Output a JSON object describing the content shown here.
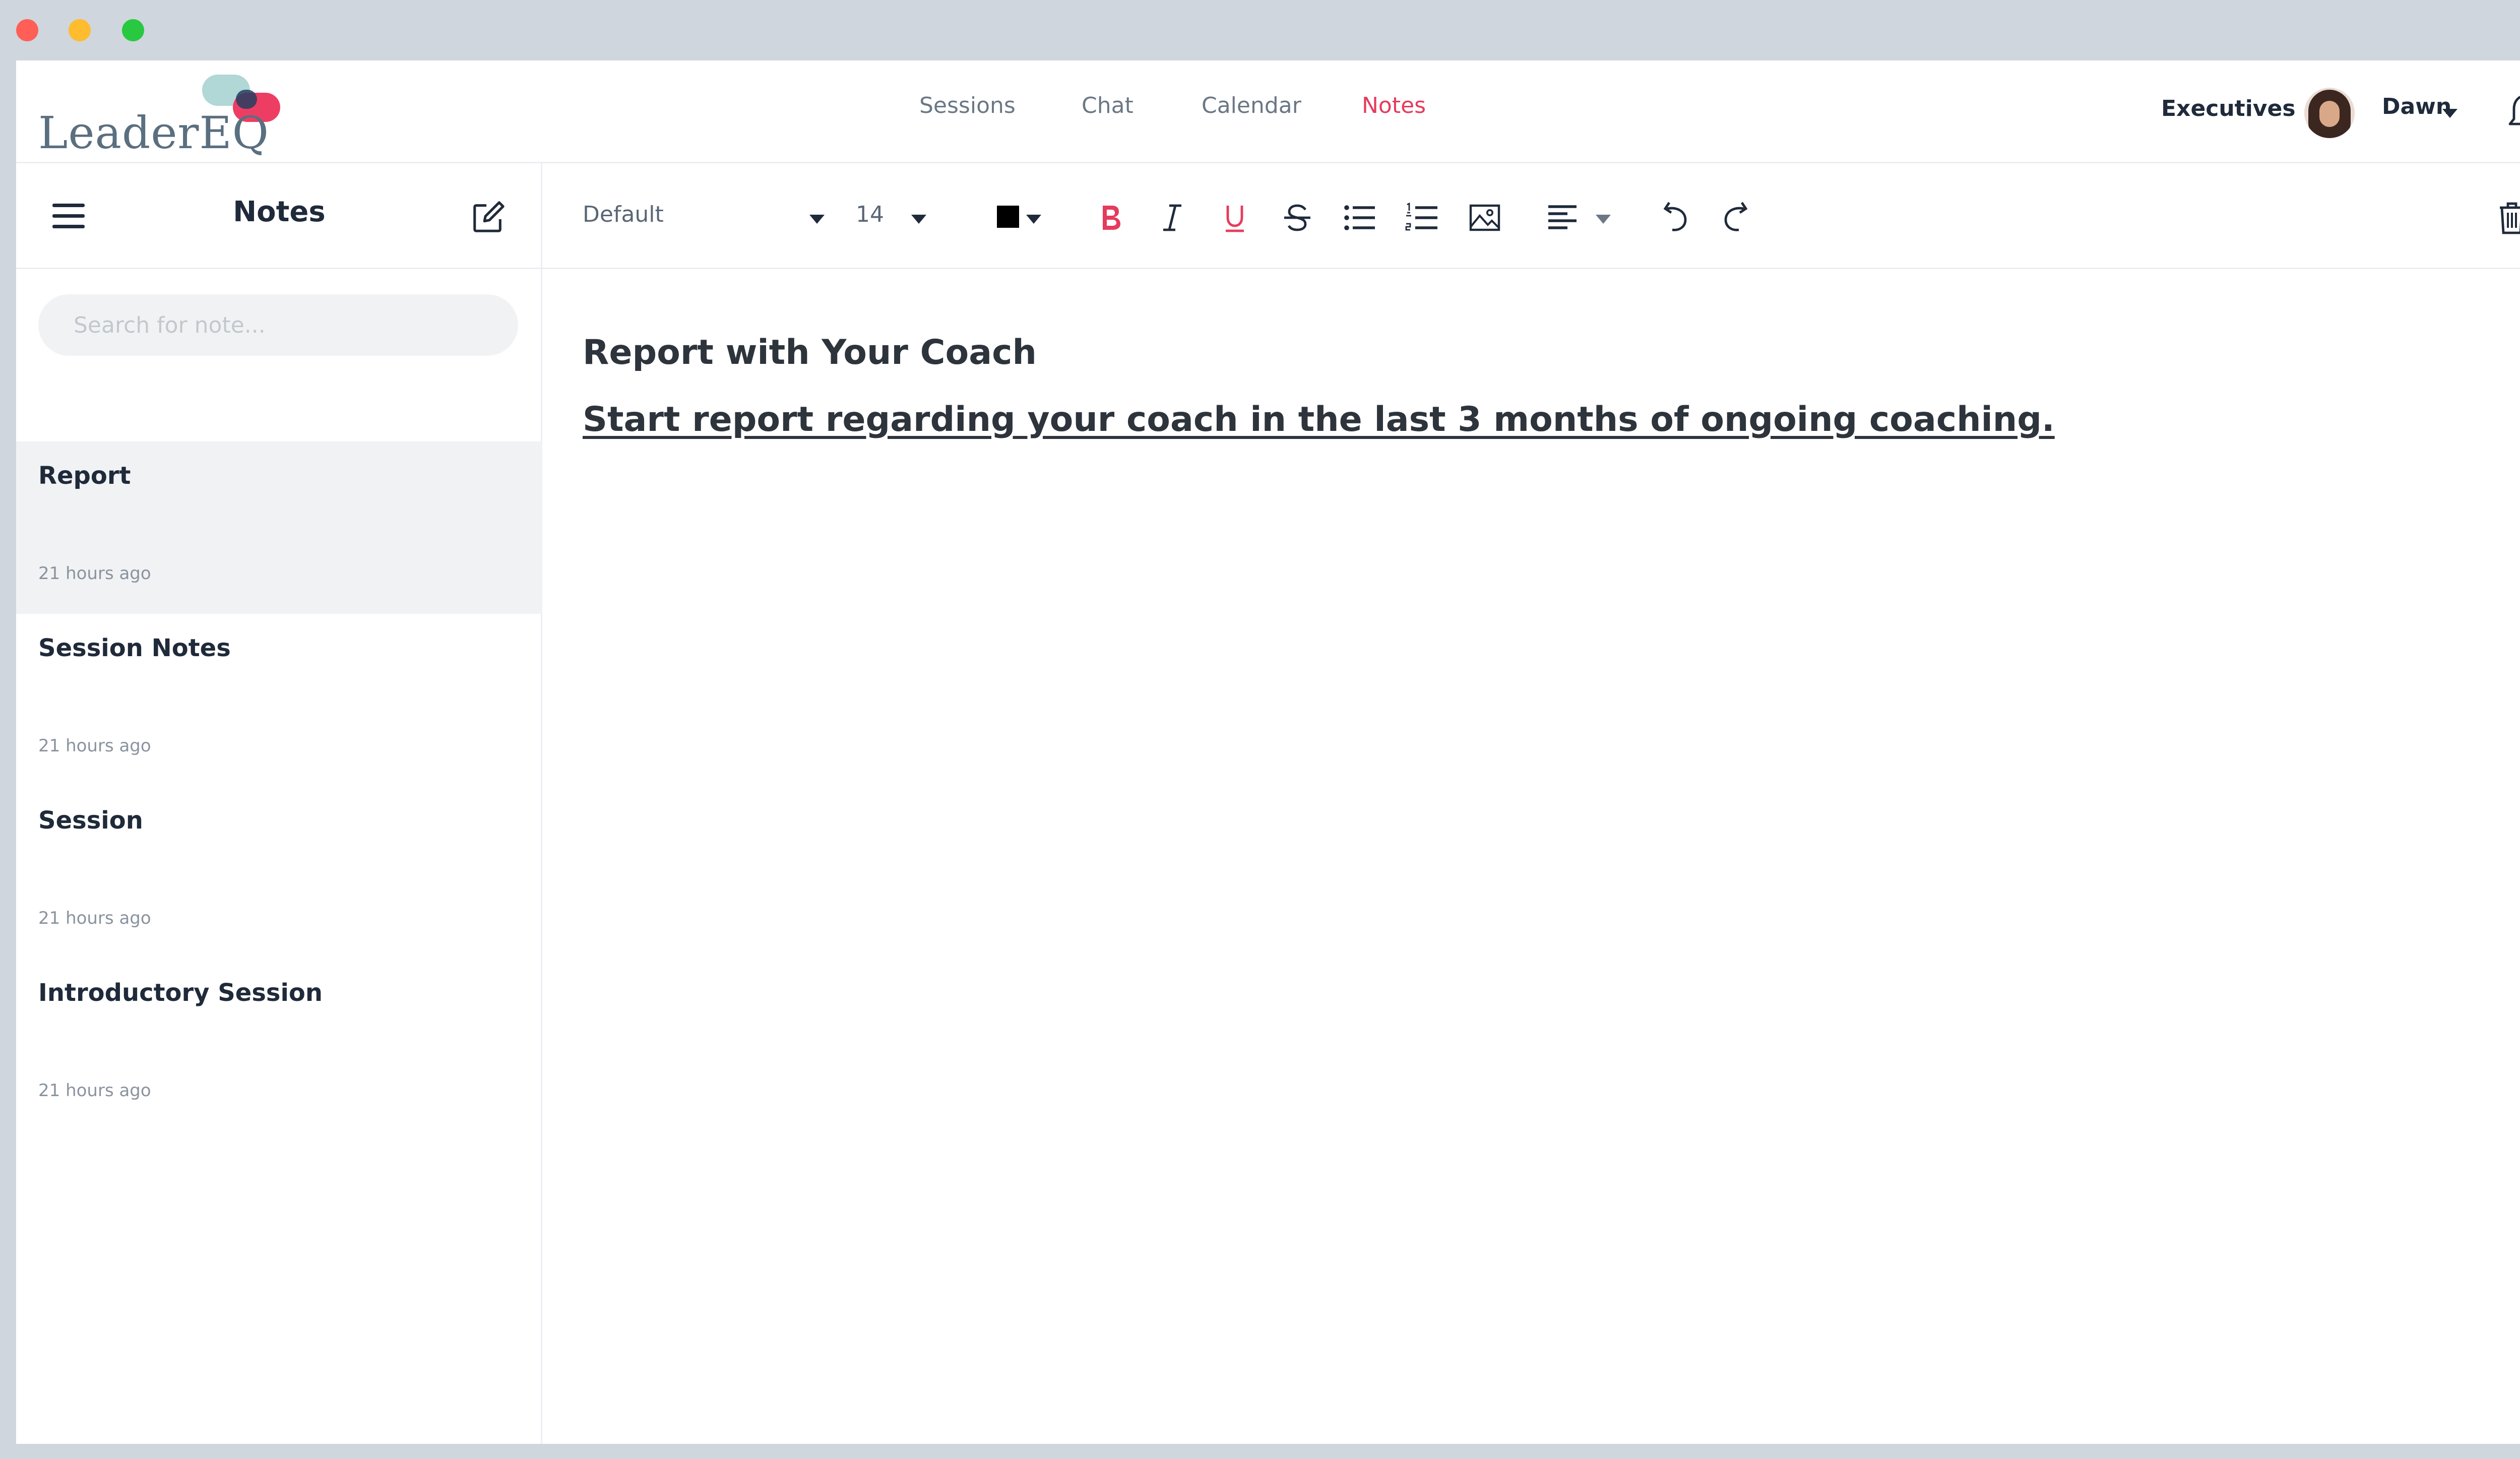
{
  "nav": {
    "items": [
      {
        "label": "Sessions",
        "active": false
      },
      {
        "label": "Chat",
        "active": false
      },
      {
        "label": "Calendar",
        "active": false
      },
      {
        "label": "Notes",
        "active": true
      }
    ],
    "accent_color": "#e53b5c"
  },
  "logo": {
    "text": "LeaderEQ"
  },
  "header": {
    "org_label": "Executives",
    "user_name": "Dawn",
    "notification_icon": "bell-icon"
  },
  "sidebar": {
    "title": "Notes",
    "menu_icon": "hamburger-icon",
    "compose_icon": "compose-icon",
    "search_placeholder": "Search for note...",
    "notes": [
      {
        "title": "Report",
        "time": "21 hours ago",
        "selected": true
      },
      {
        "title": "Session Notes",
        "time": "21 hours ago",
        "selected": false
      },
      {
        "title": "Session",
        "time": "21 hours ago",
        "selected": false
      },
      {
        "title": "Introductory Session",
        "time": "21 hours ago",
        "selected": false
      }
    ]
  },
  "toolbar": {
    "font_family": "Default",
    "font_size": "14",
    "text_color": "#000000",
    "bold_color": "#e53b5c",
    "underline_color": "#e53b5c"
  },
  "editor": {
    "title": "Report with Your Coach",
    "body": "Start report regarding your coach in the last 3 months of ongoing coaching."
  }
}
